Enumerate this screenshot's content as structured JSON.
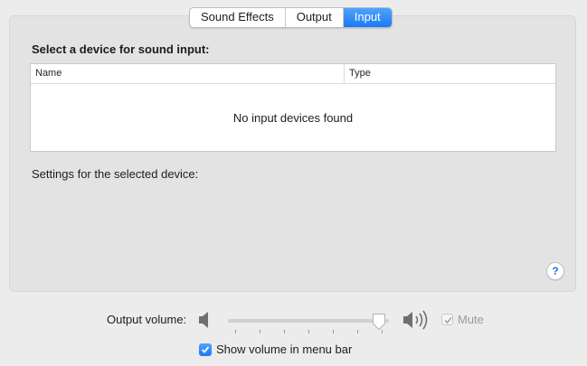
{
  "tabs": [
    {
      "label": "Sound Effects",
      "selected": false
    },
    {
      "label": "Output",
      "selected": false
    },
    {
      "label": "Input",
      "selected": true
    }
  ],
  "input": {
    "section_title": "Select a device for sound input:",
    "table": {
      "columns": [
        "Name",
        "Type"
      ],
      "empty_message": "No input devices found"
    },
    "settings_label": "Settings for the selected device:"
  },
  "help": {
    "label": "?"
  },
  "volume": {
    "label": "Output volume:",
    "level": 0.98,
    "mute_label": "Mute",
    "mute_checked": true,
    "mute_enabled": false,
    "low_icon": "speaker-low-icon",
    "high_icon": "speaker-high-icon"
  },
  "menu_bar": {
    "label": "Show volume in menu bar",
    "checked": true
  },
  "colors": {
    "accent": "#1a7af4",
    "background": "#ececec",
    "panel": "#e3e3e3"
  }
}
